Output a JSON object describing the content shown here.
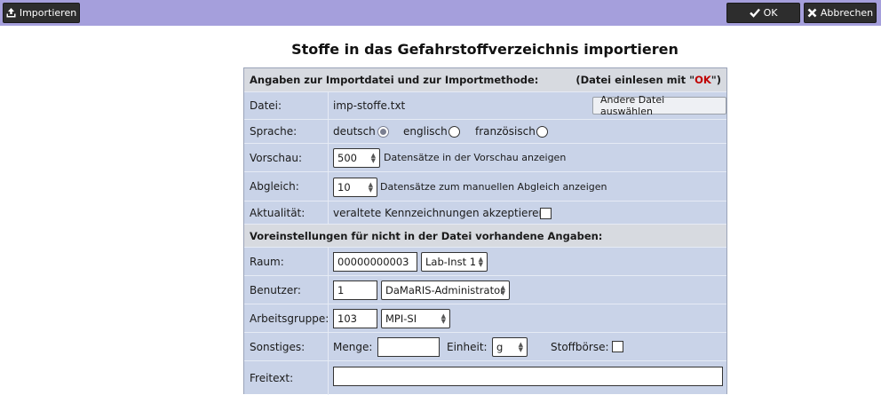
{
  "toolbar": {
    "import_label": "Importieren",
    "ok_label": "OK",
    "cancel_label": "Abbrechen"
  },
  "page": {
    "title": "Stoffe in das Gefahrstoffverzeichnis importieren"
  },
  "section1": {
    "heading": "Angaben zur Importdatei und zur Importmethode:",
    "hint_prefix": "(Datei einlesen mit \"",
    "hint_ok": "OK",
    "hint_suffix": "\")"
  },
  "file": {
    "label": "Datei:",
    "name": "imp-stoffe.txt",
    "button": "Andere Datei auswählen"
  },
  "language": {
    "label": "Sprache:",
    "options": [
      "deutsch",
      "englisch",
      "französisch"
    ],
    "selected": "deutsch"
  },
  "preview": {
    "label": "Vorschau:",
    "value": "500",
    "text": "Datensätze in der Vorschau anzeigen"
  },
  "match": {
    "label": "Abgleich:",
    "value": "10",
    "text": "Datensätze zum manuellen Abgleich anzeigen"
  },
  "actuality": {
    "label": "Aktualität:",
    "text": "veraltete Kennzeichnungen akzeptieren:",
    "checked": false
  },
  "section2": {
    "heading": "Voreinstellungen für nicht in der Datei vorhandene Angaben:"
  },
  "room": {
    "label": "Raum:",
    "code": "00000000003",
    "selected": "Lab-Inst 1"
  },
  "user": {
    "label": "Benutzer:",
    "id": "1",
    "selected": "DaMaRIS-Administrator"
  },
  "group": {
    "label": "Arbeitsgruppe:",
    "id": "103",
    "selected": "MPI-SI"
  },
  "misc": {
    "label": "Sonstiges:",
    "amount_label": "Menge:",
    "amount_value": "",
    "unit_label": "Einheit:",
    "unit_selected": "g",
    "exchange_label": "Stoffbörse:",
    "exchange_checked": false
  },
  "freetext": {
    "label": "Freitext:",
    "value": ""
  },
  "colors": {
    "toolbar_bg": "#a59fdc",
    "button_bg": "#2d2d2d",
    "form_bg": "#c9d3e8",
    "section_bg": "#d7dae0",
    "accent_red": "#c00000"
  }
}
